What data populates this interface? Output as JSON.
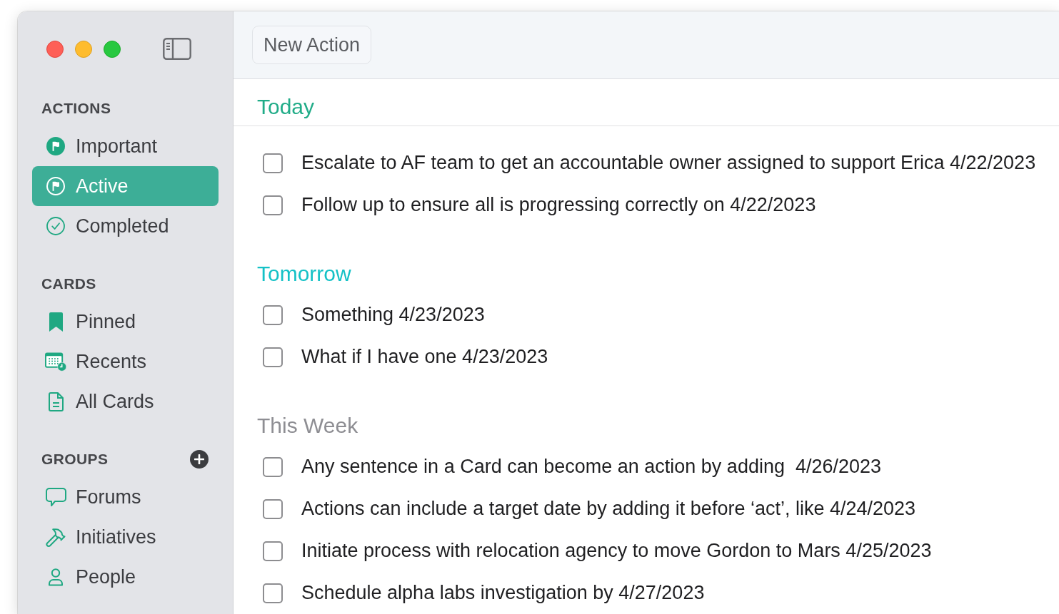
{
  "sidebar": {
    "sections": [
      {
        "title": "ACTIONS",
        "add_button": false,
        "items": [
          {
            "label": "Important",
            "selected": false
          },
          {
            "label": "Active",
            "selected": true
          },
          {
            "label": "Completed",
            "selected": false
          }
        ]
      },
      {
        "title": "CARDS",
        "add_button": false,
        "items": [
          {
            "label": "Pinned",
            "selected": false
          },
          {
            "label": "Recents",
            "selected": false
          },
          {
            "label": "All Cards",
            "selected": false
          }
        ]
      },
      {
        "title": "GROUPS",
        "add_button": true,
        "items": [
          {
            "label": "Forums",
            "selected": false
          },
          {
            "label": "Initiatives",
            "selected": false
          },
          {
            "label": "People",
            "selected": false
          }
        ]
      }
    ]
  },
  "toolbar": {
    "new_action_button": "New Action"
  },
  "sections": [
    {
      "title": "Today",
      "color": "#21ac88",
      "actions": [
        {
          "text": "Escalate to AF team to get an accountable owner assigned to support Erica 4/22/2023",
          "checked": false
        },
        {
          "text": "Follow up to ensure all is progressing correctly on 4/22/2023",
          "checked": false
        }
      ]
    },
    {
      "title": "Tomorrow",
      "color": "#14c1c6",
      "actions": [
        {
          "text": "Something 4/23/2023",
          "checked": false
        },
        {
          "text": "What if I have one 4/23/2023",
          "checked": false
        }
      ]
    },
    {
      "title": "This Week",
      "color": "#8e8e93",
      "actions": [
        {
          "text": "Any sentence in a Card can become an action by adding  4/26/2023",
          "checked": false
        },
        {
          "text": "Actions can include a target date by adding it before ‘act’, like 4/24/2023",
          "checked": false
        },
        {
          "text": "Initiate process with relocation agency to move Gordon to Mars 4/25/2023",
          "checked": false
        },
        {
          "text": "Schedule alpha labs investigation by 4/27/2023",
          "checked": false
        }
      ]
    }
  ]
}
